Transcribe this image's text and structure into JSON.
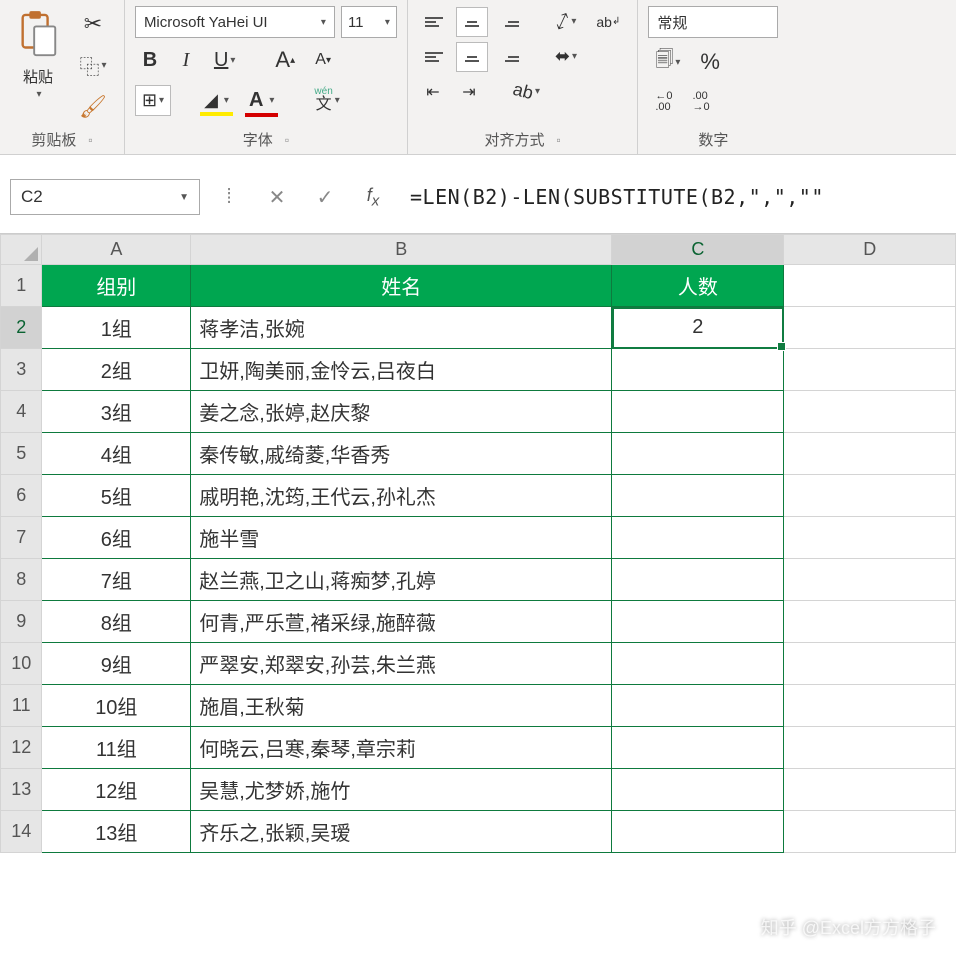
{
  "ribbon": {
    "clipboard": {
      "paste": "粘贴",
      "label": "剪贴板"
    },
    "font": {
      "name": "Microsoft YaHei UI",
      "size": "11",
      "bold": "B",
      "italic": "I",
      "underline": "U",
      "grow": "A",
      "shrink": "A",
      "phonetic": "wén",
      "phonetic2": "文",
      "label": "字体"
    },
    "alignment": {
      "wrap": "ab",
      "label": "对齐方式"
    },
    "number": {
      "format": "常规",
      "percent": "%",
      "comma": ",",
      "inc": ".0",
      "inc2": ".00",
      "dec": ".00",
      "dec2": ".0",
      "acct": "📋",
      "label": "数字"
    }
  },
  "namebox": "C2",
  "formula": "=LEN(B2)-LEN(SUBSTITUTE(B2,\",\",\"\"",
  "columns": [
    "A",
    "B",
    "C",
    "D"
  ],
  "headers": {
    "A": "组别",
    "B": "姓名",
    "C": "人数"
  },
  "rows": [
    {
      "n": 1
    },
    {
      "n": 2,
      "A": "1组",
      "B": "蒋孝洁,张婉",
      "C": "2"
    },
    {
      "n": 3,
      "A": "2组",
      "B": "卫妍,陶美丽,金怜云,吕夜白"
    },
    {
      "n": 4,
      "A": "3组",
      "B": "姜之念,张婷,赵庆黎"
    },
    {
      "n": 5,
      "A": "4组",
      "B": "秦传敏,戚绮菱,华香秀"
    },
    {
      "n": 6,
      "A": "5组",
      "B": "戚明艳,沈筠,王代云,孙礼杰"
    },
    {
      "n": 7,
      "A": "6组",
      "B": "施半雪"
    },
    {
      "n": 8,
      "A": "7组",
      "B": "赵兰燕,卫之山,蒋痴梦,孔婷"
    },
    {
      "n": 9,
      "A": "8组",
      "B": "何青,严乐萱,褚采绿,施醉薇"
    },
    {
      "n": 10,
      "A": "9组",
      "B": "严翠安,郑翠安,孙芸,朱兰燕"
    },
    {
      "n": 11,
      "A": "10组",
      "B": "施眉,王秋菊"
    },
    {
      "n": 12,
      "A": "11组",
      "B": "何晓云,吕寒,秦琴,章宗莉"
    },
    {
      "n": 13,
      "A": "12组",
      "B": "吴慧,尤梦娇,施竹"
    },
    {
      "n": 14,
      "A": "13组",
      "B": "齐乐之,张颖,吴瑷"
    }
  ],
  "active": "C2",
  "watermark": "知乎 @Excel方方格子"
}
